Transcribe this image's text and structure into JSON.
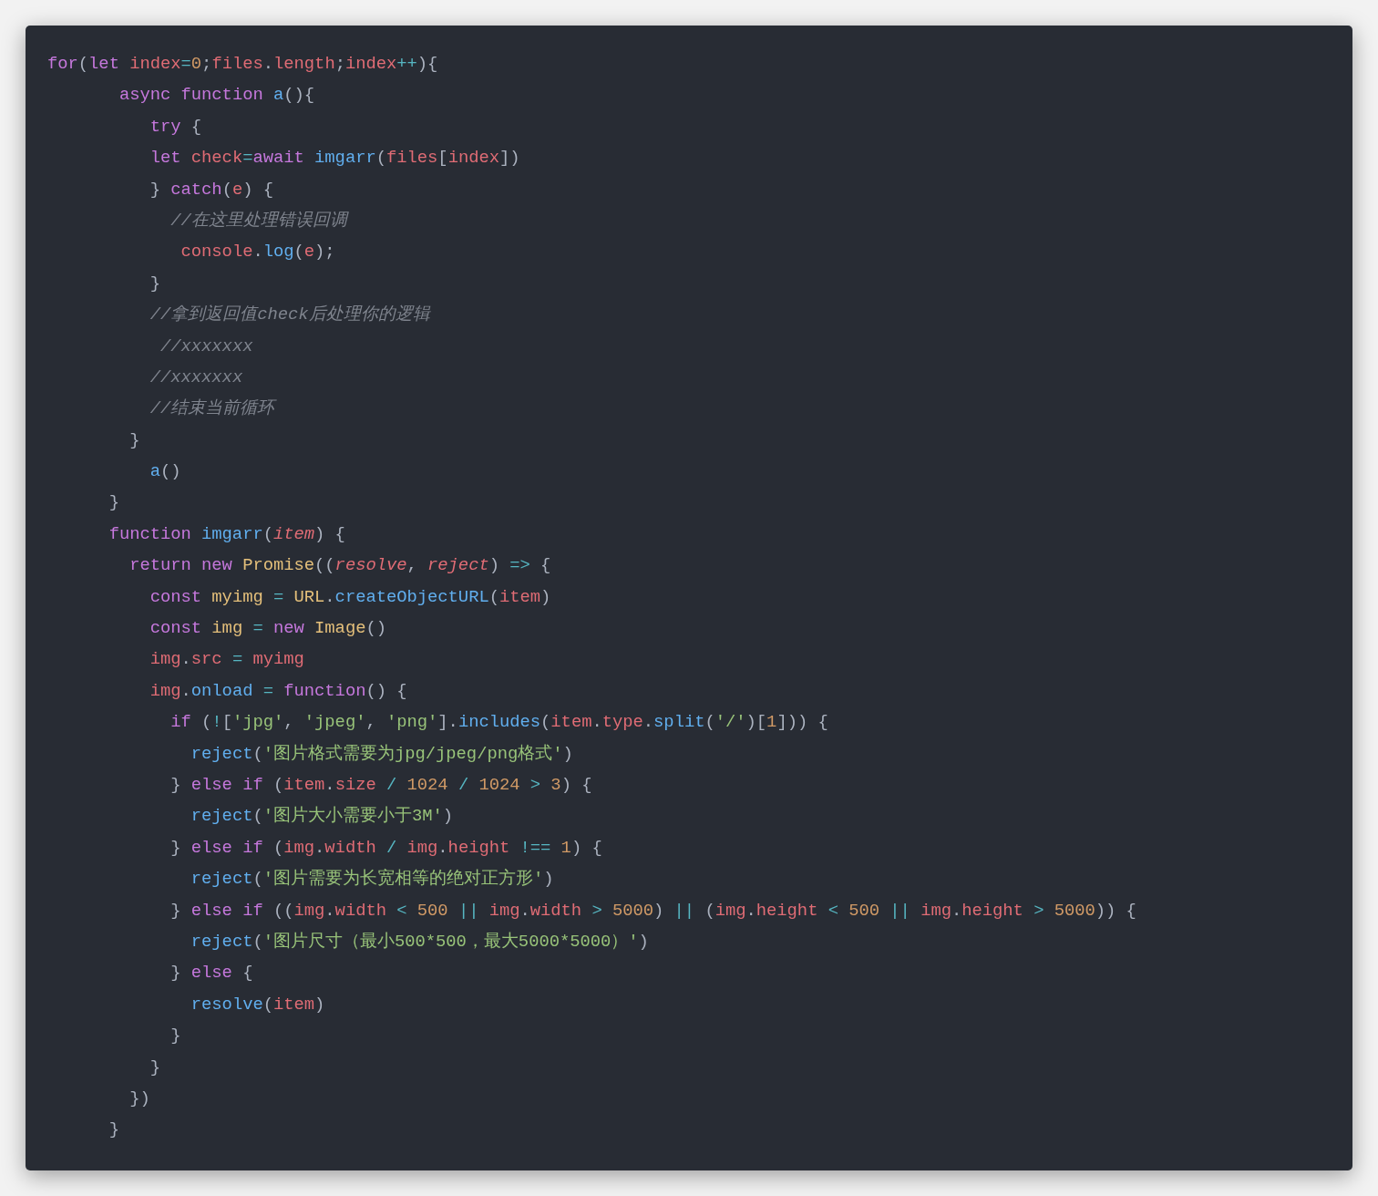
{
  "code_lines": [
    {
      "tokens": [
        {
          "kind": "k",
          "text": "for"
        },
        {
          "kind": "p",
          "text": "("
        },
        {
          "kind": "k",
          "text": "let "
        },
        {
          "kind": "v",
          "text": "index"
        },
        {
          "kind": "o",
          "text": "="
        },
        {
          "kind": "n",
          "text": "0"
        },
        {
          "kind": "p",
          "text": ";"
        },
        {
          "kind": "v",
          "text": "files"
        },
        {
          "kind": "p",
          "text": "."
        },
        {
          "kind": "v",
          "text": "length"
        },
        {
          "kind": "p",
          "text": ";"
        },
        {
          "kind": "v",
          "text": "index"
        },
        {
          "kind": "o",
          "text": "++"
        },
        {
          "kind": "p",
          "text": "){"
        }
      ]
    },
    {
      "tokens": [
        {
          "kind": "k",
          "text": "       async function "
        },
        {
          "kind": "f",
          "text": "a"
        },
        {
          "kind": "p",
          "text": "(){"
        }
      ]
    },
    {
      "tokens": [
        {
          "kind": "k",
          "text": "          try"
        },
        {
          "kind": "p",
          "text": " {"
        }
      ]
    },
    {
      "tokens": [
        {
          "kind": "k",
          "text": "          let "
        },
        {
          "kind": "v",
          "text": "check"
        },
        {
          "kind": "o",
          "text": "="
        },
        {
          "kind": "k",
          "text": "await "
        },
        {
          "kind": "f",
          "text": "imgarr"
        },
        {
          "kind": "p",
          "text": "("
        },
        {
          "kind": "v",
          "text": "files"
        },
        {
          "kind": "p",
          "text": "["
        },
        {
          "kind": "v",
          "text": "index"
        },
        {
          "kind": "p",
          "text": "])"
        }
      ]
    },
    {
      "tokens": [
        {
          "kind": "p",
          "text": "          } "
        },
        {
          "kind": "k",
          "text": "catch"
        },
        {
          "kind": "p",
          "text": "("
        },
        {
          "kind": "v",
          "text": "e"
        },
        {
          "kind": "p",
          "text": ") {"
        }
      ]
    },
    {
      "tokens": [
        {
          "kind": "c",
          "text": "            //在这里处理错误回调"
        }
      ]
    },
    {
      "tokens": [
        {
          "kind": "v",
          "text": "             console"
        },
        {
          "kind": "p",
          "text": "."
        },
        {
          "kind": "f",
          "text": "log"
        },
        {
          "kind": "p",
          "text": "("
        },
        {
          "kind": "v",
          "text": "e"
        },
        {
          "kind": "p",
          "text": ");"
        }
      ]
    },
    {
      "tokens": [
        {
          "kind": "p",
          "text": "          }"
        }
      ]
    },
    {
      "tokens": [
        {
          "kind": "c",
          "text": "          //拿到返回值check后处理你的逻辑"
        }
      ]
    },
    {
      "tokens": [
        {
          "kind": "c",
          "text": "           //xxxxxxx"
        }
      ]
    },
    {
      "tokens": [
        {
          "kind": "c",
          "text": "          //xxxxxxx"
        }
      ]
    },
    {
      "tokens": [
        {
          "kind": "c",
          "text": "          //结束当前循环"
        }
      ]
    },
    {
      "tokens": [
        {
          "kind": "p",
          "text": "        }"
        }
      ]
    },
    {
      "tokens": [
        {
          "kind": "f",
          "text": "          a"
        },
        {
          "kind": "p",
          "text": "()"
        }
      ]
    },
    {
      "tokens": [
        {
          "kind": "p",
          "text": "      }"
        }
      ]
    },
    {
      "tokens": [
        {
          "kind": "k",
          "text": "      function "
        },
        {
          "kind": "f",
          "text": "imgarr"
        },
        {
          "kind": "p",
          "text": "("
        },
        {
          "kind": "a",
          "text": "item"
        },
        {
          "kind": "p",
          "text": ") {"
        }
      ]
    },
    {
      "tokens": [
        {
          "kind": "k",
          "text": "        return new "
        },
        {
          "kind": "t",
          "text": "Promise"
        },
        {
          "kind": "p",
          "text": "(("
        },
        {
          "kind": "a",
          "text": "resolve"
        },
        {
          "kind": "p",
          "text": ", "
        },
        {
          "kind": "a",
          "text": "reject"
        },
        {
          "kind": "p",
          "text": ") "
        },
        {
          "kind": "o",
          "text": "=>"
        },
        {
          "kind": "p",
          "text": " {"
        }
      ]
    },
    {
      "tokens": [
        {
          "kind": "k",
          "text": "          const "
        },
        {
          "kind": "t",
          "text": "myimg "
        },
        {
          "kind": "o",
          "text": "= "
        },
        {
          "kind": "t",
          "text": "URL"
        },
        {
          "kind": "p",
          "text": "."
        },
        {
          "kind": "f",
          "text": "createObjectURL"
        },
        {
          "kind": "p",
          "text": "("
        },
        {
          "kind": "v",
          "text": "item"
        },
        {
          "kind": "p",
          "text": ")"
        }
      ]
    },
    {
      "tokens": [
        {
          "kind": "k",
          "text": "          const "
        },
        {
          "kind": "t",
          "text": "img "
        },
        {
          "kind": "o",
          "text": "= "
        },
        {
          "kind": "k",
          "text": "new "
        },
        {
          "kind": "t",
          "text": "Image"
        },
        {
          "kind": "p",
          "text": "()"
        }
      ]
    },
    {
      "tokens": [
        {
          "kind": "v",
          "text": "          img"
        },
        {
          "kind": "p",
          "text": "."
        },
        {
          "kind": "v",
          "text": "src "
        },
        {
          "kind": "o",
          "text": "= "
        },
        {
          "kind": "v",
          "text": "myimg"
        }
      ]
    },
    {
      "tokens": [
        {
          "kind": "v",
          "text": "          img"
        },
        {
          "kind": "p",
          "text": "."
        },
        {
          "kind": "f",
          "text": "onload "
        },
        {
          "kind": "o",
          "text": "= "
        },
        {
          "kind": "k",
          "text": "function"
        },
        {
          "kind": "p",
          "text": "() {"
        }
      ]
    },
    {
      "tokens": [
        {
          "kind": "k",
          "text": "            if"
        },
        {
          "kind": "p",
          "text": " ("
        },
        {
          "kind": "o",
          "text": "!"
        },
        {
          "kind": "p",
          "text": "["
        },
        {
          "kind": "s",
          "text": "'jpg'"
        },
        {
          "kind": "p",
          "text": ", "
        },
        {
          "kind": "s",
          "text": "'jpeg'"
        },
        {
          "kind": "p",
          "text": ", "
        },
        {
          "kind": "s",
          "text": "'png'"
        },
        {
          "kind": "p",
          "text": "]."
        },
        {
          "kind": "f",
          "text": "includes"
        },
        {
          "kind": "p",
          "text": "("
        },
        {
          "kind": "v",
          "text": "item"
        },
        {
          "kind": "p",
          "text": "."
        },
        {
          "kind": "v",
          "text": "type"
        },
        {
          "kind": "p",
          "text": "."
        },
        {
          "kind": "f",
          "text": "split"
        },
        {
          "kind": "p",
          "text": "("
        },
        {
          "kind": "s",
          "text": "'/'"
        },
        {
          "kind": "p",
          "text": ")["
        },
        {
          "kind": "n",
          "text": "1"
        },
        {
          "kind": "p",
          "text": "])) {"
        }
      ]
    },
    {
      "tokens": [
        {
          "kind": "f",
          "text": "              reject"
        },
        {
          "kind": "p",
          "text": "("
        },
        {
          "kind": "s",
          "text": "'图片格式需要为jpg/jpeg/png格式'"
        },
        {
          "kind": "p",
          "text": ")"
        }
      ]
    },
    {
      "tokens": [
        {
          "kind": "p",
          "text": "            } "
        },
        {
          "kind": "k",
          "text": "else if"
        },
        {
          "kind": "p",
          "text": " ("
        },
        {
          "kind": "v",
          "text": "item"
        },
        {
          "kind": "p",
          "text": "."
        },
        {
          "kind": "v",
          "text": "size "
        },
        {
          "kind": "o",
          "text": "/ "
        },
        {
          "kind": "n",
          "text": "1024 "
        },
        {
          "kind": "o",
          "text": "/ "
        },
        {
          "kind": "n",
          "text": "1024 "
        },
        {
          "kind": "o",
          "text": "> "
        },
        {
          "kind": "n",
          "text": "3"
        },
        {
          "kind": "p",
          "text": ") {"
        }
      ]
    },
    {
      "tokens": [
        {
          "kind": "f",
          "text": "              reject"
        },
        {
          "kind": "p",
          "text": "("
        },
        {
          "kind": "s",
          "text": "'图片大小需要小于3M'"
        },
        {
          "kind": "p",
          "text": ")"
        }
      ]
    },
    {
      "tokens": [
        {
          "kind": "p",
          "text": "            } "
        },
        {
          "kind": "k",
          "text": "else if"
        },
        {
          "kind": "p",
          "text": " ("
        },
        {
          "kind": "v",
          "text": "img"
        },
        {
          "kind": "p",
          "text": "."
        },
        {
          "kind": "v",
          "text": "width "
        },
        {
          "kind": "o",
          "text": "/ "
        },
        {
          "kind": "v",
          "text": "img"
        },
        {
          "kind": "p",
          "text": "."
        },
        {
          "kind": "v",
          "text": "height "
        },
        {
          "kind": "o",
          "text": "!== "
        },
        {
          "kind": "n",
          "text": "1"
        },
        {
          "kind": "p",
          "text": ") {"
        }
      ]
    },
    {
      "tokens": [
        {
          "kind": "f",
          "text": "              reject"
        },
        {
          "kind": "p",
          "text": "("
        },
        {
          "kind": "s",
          "text": "'图片需要为长宽相等的绝对正方形'"
        },
        {
          "kind": "p",
          "text": ")"
        }
      ]
    },
    {
      "tokens": [
        {
          "kind": "p",
          "text": "            } "
        },
        {
          "kind": "k",
          "text": "else if"
        },
        {
          "kind": "p",
          "text": " (("
        },
        {
          "kind": "v",
          "text": "img"
        },
        {
          "kind": "p",
          "text": "."
        },
        {
          "kind": "v",
          "text": "width "
        },
        {
          "kind": "o",
          "text": "< "
        },
        {
          "kind": "n",
          "text": "500 "
        },
        {
          "kind": "o",
          "text": "|| "
        },
        {
          "kind": "v",
          "text": "img"
        },
        {
          "kind": "p",
          "text": "."
        },
        {
          "kind": "v",
          "text": "width "
        },
        {
          "kind": "o",
          "text": "> "
        },
        {
          "kind": "n",
          "text": "5000"
        },
        {
          "kind": "p",
          "text": ") "
        },
        {
          "kind": "o",
          "text": "||"
        },
        {
          "kind": "p",
          "text": " ("
        },
        {
          "kind": "v",
          "text": "img"
        },
        {
          "kind": "p",
          "text": "."
        },
        {
          "kind": "v",
          "text": "height "
        },
        {
          "kind": "o",
          "text": "< "
        },
        {
          "kind": "n",
          "text": "500 "
        },
        {
          "kind": "o",
          "text": "|| "
        },
        {
          "kind": "v",
          "text": "img"
        },
        {
          "kind": "p",
          "text": "."
        },
        {
          "kind": "v",
          "text": "height "
        },
        {
          "kind": "o",
          "text": "> "
        },
        {
          "kind": "n",
          "text": "5000"
        },
        {
          "kind": "p",
          "text": ")) {"
        }
      ]
    },
    {
      "tokens": [
        {
          "kind": "f",
          "text": "              reject"
        },
        {
          "kind": "p",
          "text": "("
        },
        {
          "kind": "s",
          "text": "'图片尺寸（最小500*500，最大5000*5000）'"
        },
        {
          "kind": "p",
          "text": ")"
        }
      ]
    },
    {
      "tokens": [
        {
          "kind": "p",
          "text": "            } "
        },
        {
          "kind": "k",
          "text": "else"
        },
        {
          "kind": "p",
          "text": " {"
        }
      ]
    },
    {
      "tokens": [
        {
          "kind": "f",
          "text": "              resolve"
        },
        {
          "kind": "p",
          "text": "("
        },
        {
          "kind": "v",
          "text": "item"
        },
        {
          "kind": "p",
          "text": ")"
        }
      ]
    },
    {
      "tokens": [
        {
          "kind": "p",
          "text": "            }"
        }
      ]
    },
    {
      "tokens": [
        {
          "kind": "p",
          "text": "          }"
        }
      ]
    },
    {
      "tokens": [
        {
          "kind": "p",
          "text": "        })"
        }
      ]
    },
    {
      "tokens": [
        {
          "kind": "p",
          "text": "      }"
        }
      ]
    }
  ]
}
